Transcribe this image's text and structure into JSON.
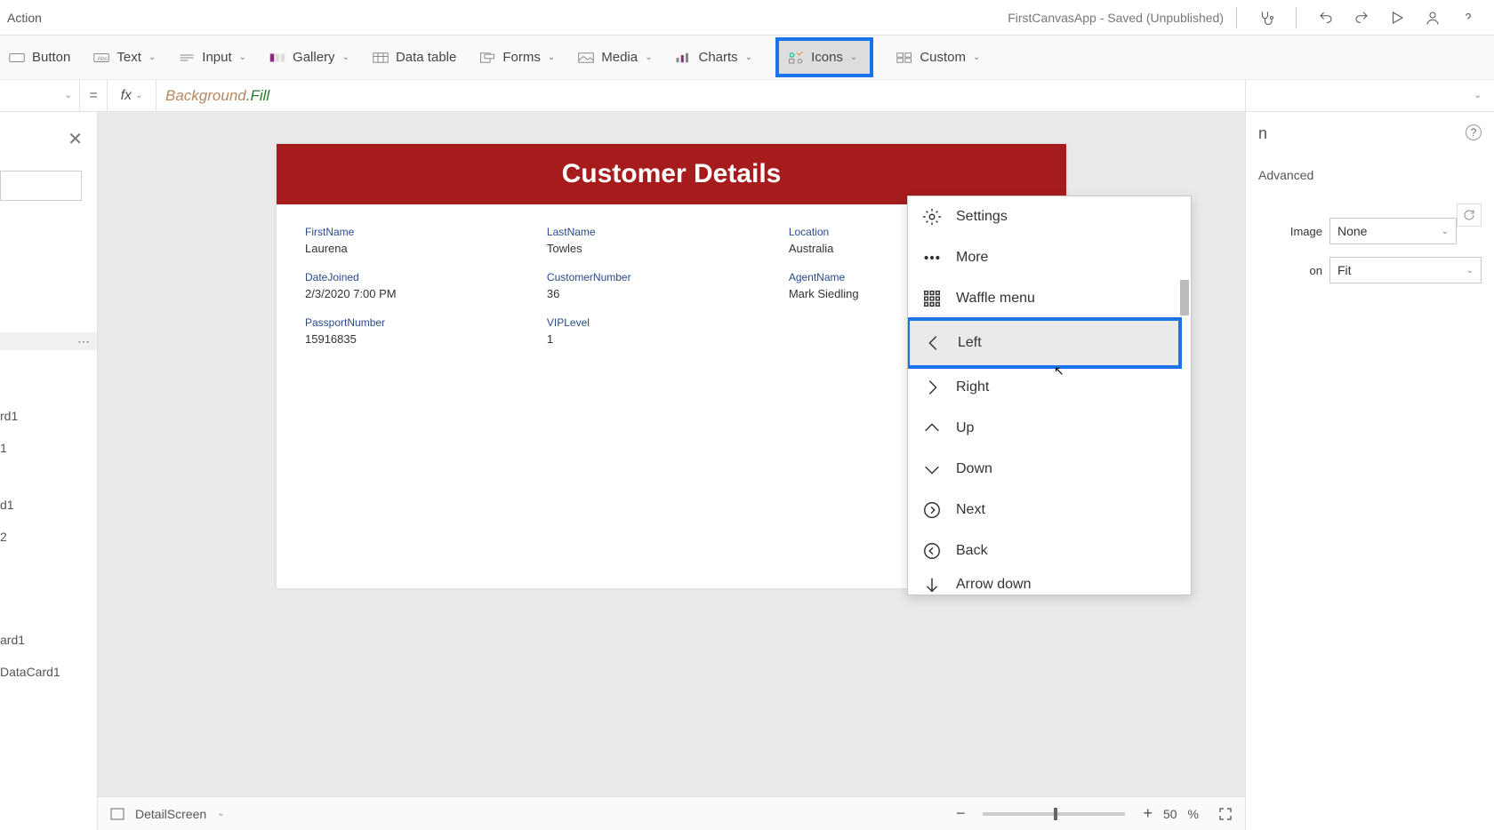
{
  "topbar": {
    "tab": "Action",
    "title": "FirstCanvasApp - Saved (Unpublished)"
  },
  "ribbon": {
    "button": "Button",
    "text": "Text",
    "input": "Input",
    "gallery": "Gallery",
    "datatable": "Data table",
    "forms": "Forms",
    "media": "Media",
    "charts": "Charts",
    "icons": "Icons",
    "custom": "Custom"
  },
  "formula": {
    "eq": "=",
    "fx": "fx",
    "tok1": "Background",
    "tok2": ".Fill"
  },
  "tree": {
    "nodes": [
      "rd1",
      "1",
      "d1",
      "2",
      "ard1",
      "DataCard1"
    ]
  },
  "canvas_title": "Customer Details",
  "fields": {
    "r1": [
      {
        "label": "FirstName",
        "value": "Laurena"
      },
      {
        "label": "LastName",
        "value": "Towles"
      },
      {
        "label": "Location",
        "value": "Australia"
      }
    ],
    "r2": [
      {
        "label": "DateJoined",
        "value": "2/3/2020 7:00 PM"
      },
      {
        "label": "CustomerNumber",
        "value": "36"
      },
      {
        "label": "AgentName",
        "value": "Mark Siedling"
      }
    ],
    "r3": [
      {
        "label": "PassportNumber",
        "value": "15916835"
      },
      {
        "label": "VIPLevel",
        "value": "1"
      }
    ]
  },
  "icons_menu": {
    "items": [
      {
        "key": "settings",
        "label": "Settings"
      },
      {
        "key": "more",
        "label": "More"
      },
      {
        "key": "waffle",
        "label": "Waffle menu"
      },
      {
        "key": "left",
        "label": "Left",
        "highlight": true
      },
      {
        "key": "right",
        "label": "Right"
      },
      {
        "key": "up",
        "label": "Up"
      },
      {
        "key": "down",
        "label": "Down"
      },
      {
        "key": "next",
        "label": "Next"
      },
      {
        "key": "back",
        "label": "Back"
      },
      {
        "key": "arrowdown",
        "label": "Arrow down"
      }
    ]
  },
  "rightpanel": {
    "letter": "n",
    "tab_advanced": "Advanced",
    "image_label": "Image",
    "image_value": "None",
    "pos_label": "on",
    "pos_value": "Fit"
  },
  "statusbar": {
    "screen": "DetailScreen",
    "zoom": "50",
    "pct": "%"
  }
}
